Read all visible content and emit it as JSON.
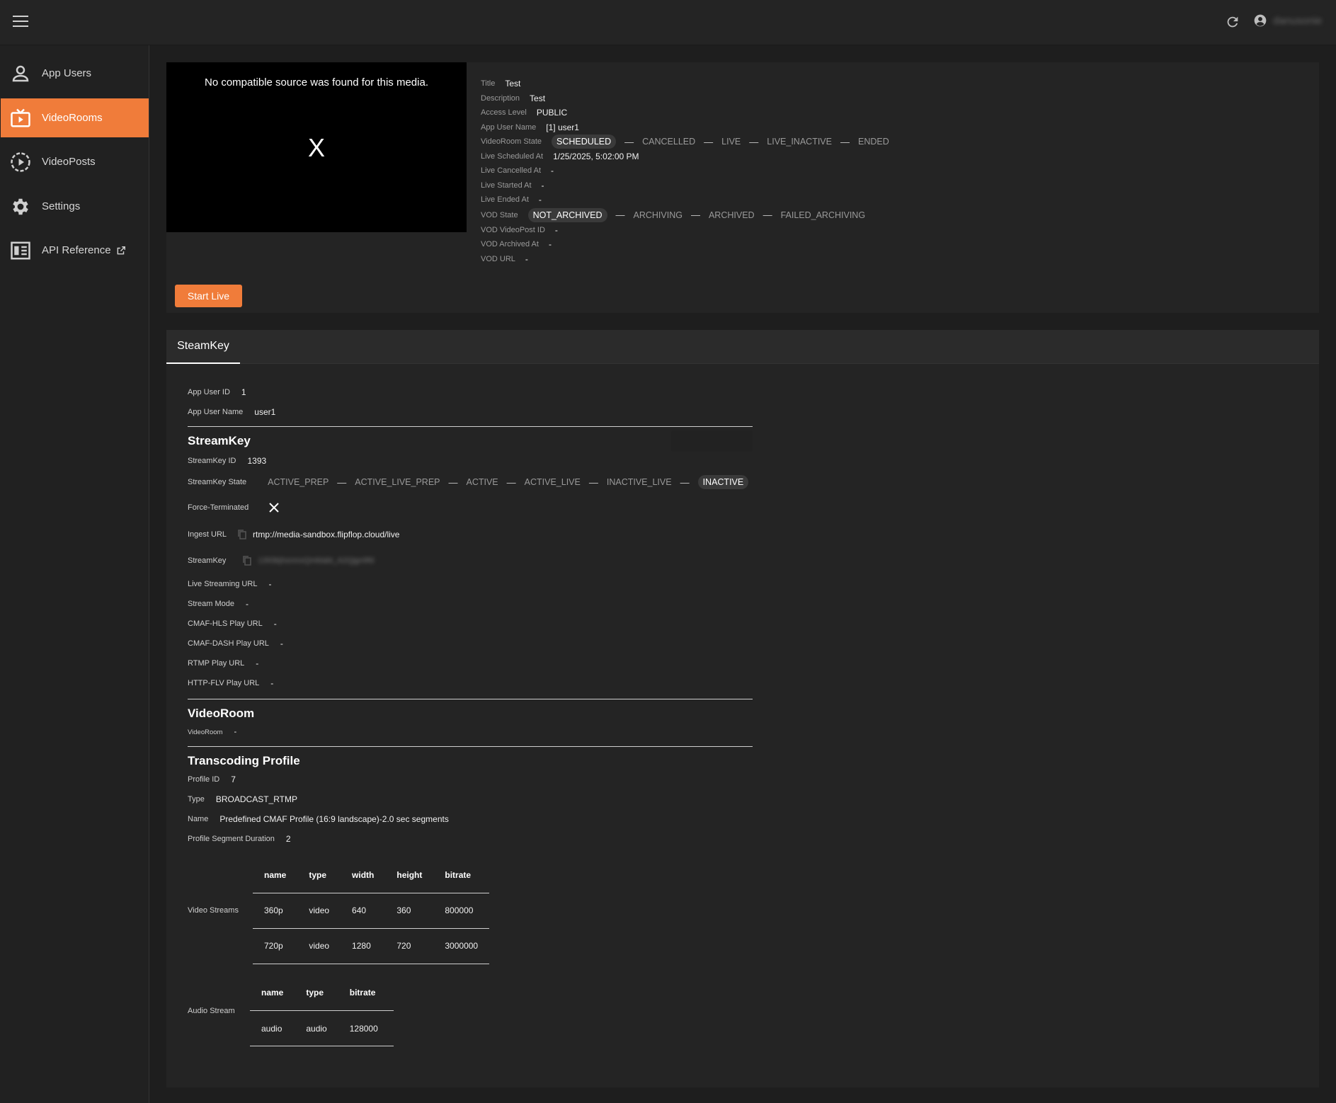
{
  "topbar": {
    "menu_icon": "hamburger-menu-icon",
    "refresh_icon": "refresh-icon",
    "user_icon": "account-circle-icon",
    "user_name": "danusonie"
  },
  "sidebar": {
    "items": [
      {
        "label": "App Users",
        "icon": "person-icon"
      },
      {
        "label": "VideoRooms",
        "icon": "tv-icon"
      },
      {
        "label": "VideoPosts",
        "icon": "play-circle-icon"
      },
      {
        "label": "Settings",
        "icon": "gear-icon"
      },
      {
        "label": "API Reference",
        "icon": "document-icon",
        "external_icon": "external-link-icon"
      }
    ]
  },
  "player": {
    "message": "No compatible source was found for this media.",
    "x": "X"
  },
  "room": {
    "title_label": "Title",
    "title": "Test",
    "description_label": "Description",
    "description": "Test",
    "access_label": "Access Level",
    "access": "PUBLIC",
    "appuser_label": "App User Name",
    "appuser": "[1] user1",
    "state_label": "VideoRoom State",
    "states": [
      "SCHEDULED",
      "CANCELLED",
      "LIVE",
      "LIVE_INACTIVE",
      "ENDED"
    ],
    "scheduled_label": "Live Scheduled At",
    "scheduled": "1/25/2025, 5:02:00 PM",
    "cancelled_label": "Live Cancelled At",
    "cancelled": "-",
    "started_label": "Live Started At",
    "started": "-",
    "ended_label": "Live Ended At",
    "ended": "-",
    "vod_state_label": "VOD State",
    "vod_states": [
      "NOT_ARCHIVED",
      "ARCHIVING",
      "ARCHIVED",
      "FAILED_ARCHIVING"
    ],
    "vod_post_label": "VOD VideoPost ID",
    "vod_post": "-",
    "vod_archived_label": "VOD Archived At",
    "vod_archived": "-",
    "vod_url_label": "VOD URL",
    "vod_url": "-"
  },
  "start_live_label": "Start Live",
  "tab_label": "SteamKey",
  "streamkey": {
    "appuser_id_label": "App User ID",
    "appuser_id": "1",
    "appuser_name_label": "App User Name",
    "appuser_name": "user1",
    "section_title": "StreamKey",
    "id_label": "StreamKey ID",
    "id": "1393",
    "state_label": "StreamKey State",
    "states": [
      "ACTIVE_PREP",
      "ACTIVE_LIVE_PREP",
      "ACTIVE",
      "ACTIVE_LIVE",
      "INACTIVE_LIVE",
      "INACTIVE"
    ],
    "force_label": "Force-Terminated",
    "force_icon": "close-icon",
    "ingest_label": "Ingest URL",
    "ingest": "rtmp://media-sandbox.flipflop.cloud/live",
    "key_label": "StreamKey",
    "key": "1393kjhsnmxQmklabt_A2Qjgn9fd",
    "live_url_label": "Live Streaming URL",
    "live_url": "-",
    "mode_label": "Stream Mode",
    "mode": "-",
    "hls_label": "CMAF-HLS Play URL",
    "hls": "-",
    "dash_label": "CMAF-DASH Play URL",
    "dash": "-",
    "rtmp_label": "RTMP Play URL",
    "rtmp": "-",
    "flv_label": "HTTP-FLV Play URL",
    "flv": "-",
    "copy_icon": "copy-icon"
  },
  "videoroom": {
    "title": "VideoRoom",
    "label": "VideoRoom",
    "value": "-"
  },
  "transcoding": {
    "title": "Transcoding Profile",
    "profile_id_label": "Profile ID",
    "profile_id": "7",
    "type_label": "Type",
    "type": "BROADCAST_RTMP",
    "name_label": "Name",
    "name": "Predefined CMAF Profile (16:9 landscape)-2.0 sec segments",
    "seg_label": "Profile Segment Duration",
    "seg": "2",
    "video_label": "Video Streams",
    "video_headers": [
      "name",
      "type",
      "width",
      "height",
      "bitrate"
    ],
    "video_rows": [
      [
        "360p",
        "video",
        "640",
        "360",
        "800000"
      ],
      [
        "720p",
        "video",
        "1280",
        "720",
        "3000000"
      ]
    ],
    "audio_label": "Audio Stream",
    "audio_headers": [
      "name",
      "type",
      "bitrate"
    ],
    "audio_rows": [
      [
        "audio",
        "audio",
        "128000"
      ]
    ]
  }
}
